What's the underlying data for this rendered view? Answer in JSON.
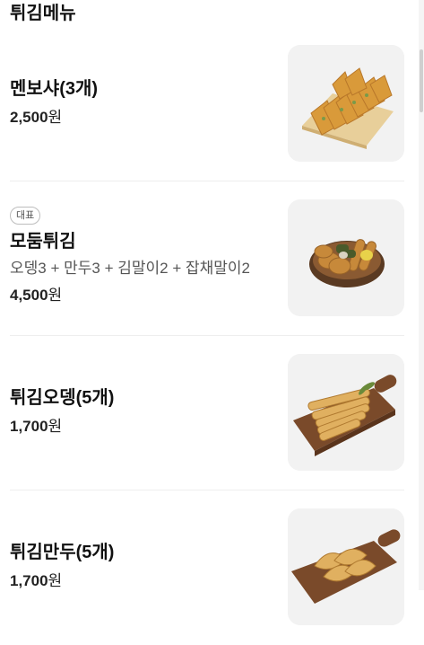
{
  "section": {
    "title": "튀김메뉴"
  },
  "items": [
    {
      "badge": "",
      "name": "멘보샤(3개)",
      "desc": "",
      "price": "2,500",
      "currency": "원",
      "image_icon": "menbosha-image"
    },
    {
      "badge": "대표",
      "name": "모둠튀김",
      "desc": "오뎅3 + 만두3 + 김말이2 + 잡채말이2",
      "price": "4,500",
      "currency": "원",
      "image_icon": "mixed-fries-image"
    },
    {
      "badge": "",
      "name": "튀김오뎅(5개)",
      "desc": "",
      "price": "1,700",
      "currency": "원",
      "image_icon": "fried-fishcake-image"
    },
    {
      "badge": "",
      "name": "튀김만두(5개)",
      "desc": "",
      "price": "1,700",
      "currency": "원",
      "image_icon": "fried-dumpling-image"
    }
  ],
  "colors": {
    "thumb_bg": "#f2f2f2",
    "divider": "#eeeeee",
    "fry_gold": "#d99a3a",
    "board_wood": "#7a4a2a"
  }
}
